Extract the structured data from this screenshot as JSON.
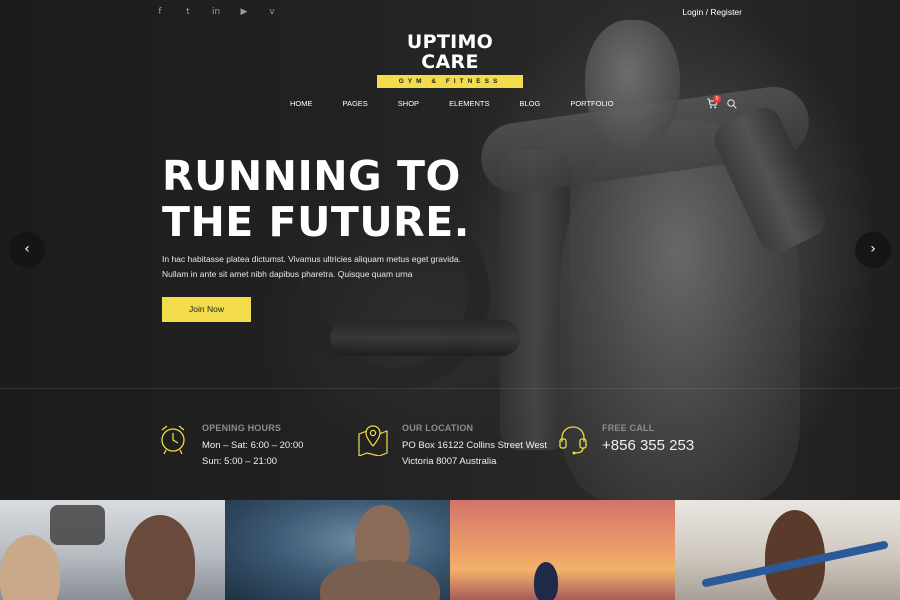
{
  "header": {
    "social_icons": [
      "facebook-icon",
      "twitter-icon",
      "linkedin-icon",
      "youtube-icon",
      "vimeo-icon"
    ],
    "social_glyphs": [
      "f",
      "t",
      "in",
      "▶",
      "v"
    ],
    "login_label": "Login / Register"
  },
  "logo": {
    "title": "UPTIMO CARE",
    "subtitle": "GYM & FITNESS"
  },
  "nav": {
    "items": [
      "HOME",
      "PAGES",
      "SHOP",
      "ELEMENTS",
      "BLOG",
      "PORTFOLIO"
    ],
    "cart_count": "0"
  },
  "hero": {
    "headline_line1": "RUNNING TO",
    "headline_line2": "THE FUTURE.",
    "lead_line1": "In hac habitasse platea dictumst. Vivamus ultricies aliquam metus eget gravida.",
    "lead_line2": "Nullam in ante sit amet nibh dapibus pharetra. Quisque quam urna",
    "cta_label": "Join Now",
    "prev_arrow": "‹",
    "next_arrow": "›"
  },
  "info": {
    "hours": {
      "title": "OPENING HOURS",
      "line1": "Mon – Sat: 6:00 – 20:00",
      "line2": "Sun: 5:00 – 21:00"
    },
    "location": {
      "title": "OUR LOCATION",
      "line1": "PO Box 16122 Collins Street West",
      "line2": "Victoria 8007 Australia"
    },
    "call": {
      "title": "FREE CALL",
      "phone": "+856 355 253"
    }
  },
  "colors": {
    "accent": "#f2dc4b",
    "background": "#1e1e1e",
    "badge": "#e23c3c"
  }
}
